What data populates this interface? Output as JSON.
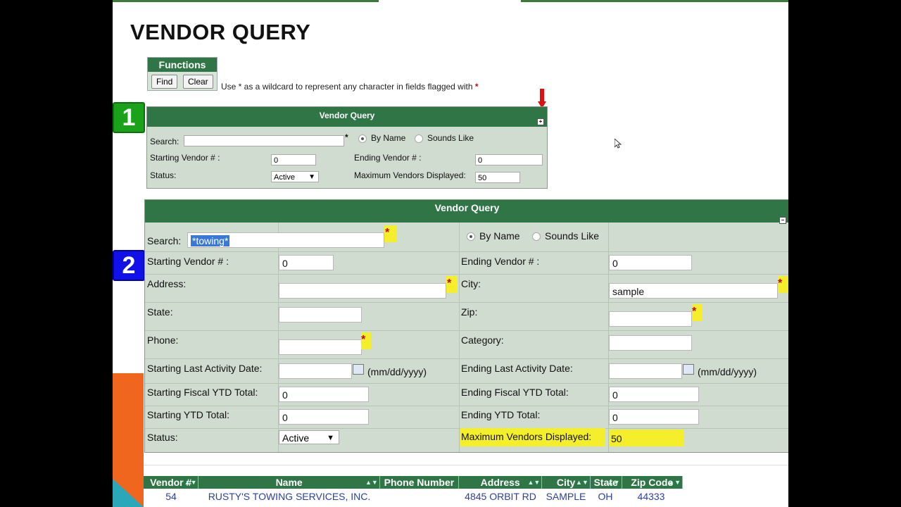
{
  "page": {
    "title": "VENDOR QUERY"
  },
  "badges": {
    "one": "1",
    "two": "2"
  },
  "functions": {
    "title": "Functions",
    "find": "Find",
    "clear": "Clear",
    "hint": "Use * as a wildcard to represent any character in fields flagged with",
    "flag": "*"
  },
  "panel1": {
    "title": "Vendor Query",
    "search_label": "Search:",
    "search_value": "",
    "by_name": "By Name",
    "sounds_like": "Sounds Like",
    "start_vendor_label": "Starting Vendor # :",
    "start_vendor_value": "0",
    "end_vendor_label": "Ending Vendor # :",
    "end_vendor_value": "0",
    "status_label": "Status:",
    "status_value": "Active",
    "max_label": "Maximum Vendors Displayed:",
    "max_value": "50"
  },
  "panel2": {
    "title": "Vendor Query",
    "search_label": "Search:",
    "search_value": "*towing*",
    "by_name": "By Name",
    "sounds_like": "Sounds Like",
    "start_vendor_label": "Starting Vendor # :",
    "start_vendor_value": "0",
    "end_vendor_label": "Ending Vendor # :",
    "end_vendor_value": "0",
    "address_label": "Address:",
    "address_value": "",
    "city_label": "City:",
    "city_value": "sample",
    "state_label": "State:",
    "zip_label": "Zip:",
    "phone_label": "Phone:",
    "category_label": "Category:",
    "start_activity_label": "Starting Last Activity Date:",
    "end_activity_label": "Ending Last Activity Date:",
    "date_format": "(mm/dd/yyyy)",
    "start_fiscal_label": "Starting Fiscal YTD Total:",
    "start_fiscal_value": "0",
    "end_fiscal_label": "Ending Fiscal YTD Total:",
    "end_fiscal_value": "0",
    "start_ytd_label": "Starting YTD Total:",
    "start_ytd_value": "0",
    "end_ytd_label": "Ending YTD Total:",
    "end_ytd_value": "0",
    "status_label": "Status:",
    "status_value": "Active",
    "max_label": "Maximum Vendors Displayed:",
    "max_value": "50",
    "flag": "*"
  },
  "results": {
    "columns": [
      "Vendor #",
      "Name",
      "Phone Number",
      "Address",
      "City",
      "State",
      "Zip Code"
    ],
    "rows": [
      {
        "vendor": "54",
        "name": "RUSTY'S TOWING SERVICES, INC.",
        "phone": "",
        "address": "4845 ORBIT RD",
        "city": "SAMPLE",
        "state": "OH",
        "zip": "44333"
      }
    ]
  },
  "colors": {
    "header_green": "#2f7545",
    "panel_bg": "#cfdccf",
    "highlight": "#f5ee2a",
    "badge1": "#1aa31a",
    "badge2": "#1010e8"
  }
}
